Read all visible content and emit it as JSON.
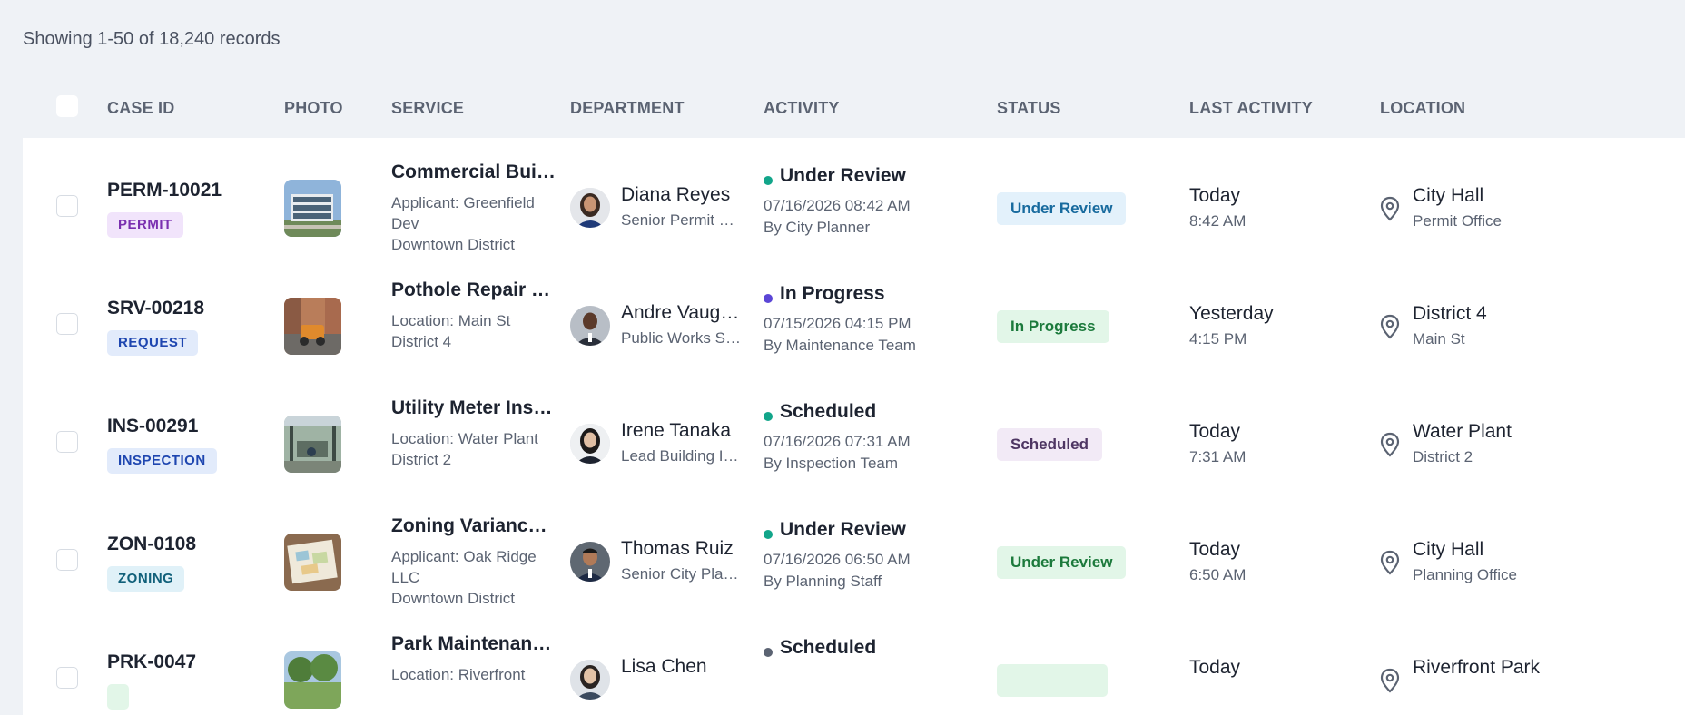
{
  "summary": "Showing 1-50 of 18,240 records",
  "columns": {
    "case_id": "CASE ID",
    "photo": "PHOTO",
    "service": "SERVICE",
    "department": "DEPARTMENT",
    "activity": "ACTIVITY",
    "status": "STATUS",
    "last_activity": "LAST ACTIVITY",
    "location": "LOCATION"
  },
  "rows": [
    {
      "case_id": "PERM-10021",
      "tag": "PERMIT",
      "tag_color": "#7a2fb0",
      "tag_bg": "#f1e4fb",
      "photo_icon": "building-photo",
      "service_title": "Commercial Building Permit",
      "service_lines": [
        "Applicant: Greenfield",
        "Dev",
        "Downtown District"
      ],
      "person_name": "Diana Reyes",
      "person_role": "Senior Permit Coordinator",
      "activity_title": "Under Review",
      "activity_dot": "#12a58a",
      "activity_date": "07/16/2026 08:42 AM",
      "activity_by": "By City Planner",
      "status": "Under Review",
      "status_color": "#176a9e",
      "status_bg": "#e3f1fb",
      "last_main": "Today",
      "last_sub": "8:42 AM",
      "location_main": "City Hall",
      "location_sub": "Permit Office"
    },
    {
      "case_id": "SRV-00218",
      "tag": "REQUEST",
      "tag_color": "#1e46b0",
      "tag_bg": "#e2ebfb",
      "photo_icon": "roadwork-photo",
      "service_title": "Pothole Repair Request",
      "service_lines": [
        "Location: Main St",
        "District 4"
      ],
      "person_name": "Andre Vaughn",
      "person_role": "Public Works Supervisor",
      "activity_title": "In Progress",
      "activity_dot": "#5b46d6",
      "activity_date": "07/15/2026 04:15 PM",
      "activity_by": "By Maintenance Team",
      "status": "In Progress",
      "status_color": "#1c7a3c",
      "status_bg": "#e2f6e8",
      "last_main": "Yesterday",
      "last_sub": "4:15 PM",
      "location_main": "District 4",
      "location_sub": "Main St"
    },
    {
      "case_id": "INS-00291",
      "tag": "INSPECTION",
      "tag_color": "#1e46b0",
      "tag_bg": "#e2ebfb",
      "photo_icon": "utility-photo",
      "service_title": "Utility Meter Inspection",
      "service_lines": [
        "Location: Water Plant",
        "District 2"
      ],
      "person_name": "Irene Tanaka",
      "person_role": "Lead Building Inspector",
      "activity_title": "Scheduled",
      "activity_dot": "#12a58a",
      "activity_date": "07/16/2026 07:31 AM",
      "activity_by": "By Inspection Team",
      "status": "Scheduled",
      "status_color": "#4e3663",
      "status_bg": "#f2eaf6",
      "last_main": "Today",
      "last_sub": "7:31 AM",
      "location_main": "Water Plant",
      "location_sub": "District 2"
    },
    {
      "case_id": "ZON-0108",
      "tag": "ZONING",
      "tag_color": "#11607a",
      "tag_bg": "#e0f1f8",
      "photo_icon": "zoning-map-photo",
      "service_title": "Zoning Variance Request",
      "service_lines": [
        "Applicant: Oak Ridge",
        "LLC",
        "Downtown District"
      ],
      "person_name": "Thomas Ruiz",
      "person_role": "Senior City Planner",
      "activity_title": "Under Review",
      "activity_dot": "#12a58a",
      "activity_date": "07/16/2026 06:50 AM",
      "activity_by": "By Planning Staff",
      "status": "Under Review",
      "status_color": "#1c7a3c",
      "status_bg": "#e2f6e8",
      "last_main": "Today",
      "last_sub": "6:50 AM",
      "location_main": "City Hall",
      "location_sub": "Planning Office"
    },
    {
      "case_id": "PRK-0047",
      "tag": "",
      "tag_color": "#1c7a3c",
      "tag_bg": "#e2f6e8",
      "photo_icon": "park-photo",
      "service_title": "Park Maintenance Request",
      "service_lines": [
        "Location: Riverfront"
      ],
      "person_name": "Lisa Chen",
      "person_role": "",
      "activity_title": "Scheduled",
      "activity_dot": "#5b6372",
      "activity_date": "",
      "activity_by": "",
      "status": "",
      "status_color": "#1c7a3c",
      "status_bg": "#e2f6e8",
      "last_main": "Today",
      "last_sub": "",
      "location_main": "Riverfront Park",
      "location_sub": ""
    }
  ]
}
